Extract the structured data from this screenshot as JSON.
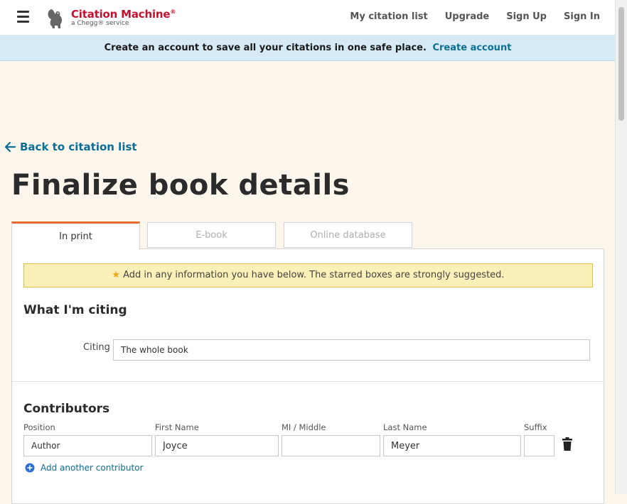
{
  "header": {
    "brand_name": "Citation Machine",
    "brand_mark": "®",
    "brand_sub": "a Chegg® service",
    "nav": [
      "My citation list",
      "Upgrade",
      "Sign Up",
      "Sign In"
    ]
  },
  "banner": {
    "text": "Create an account to save all your citations in one safe place.",
    "link": "Create account"
  },
  "back_link": "Back to citation list",
  "page_title": "Finalize book details",
  "tabs": [
    {
      "label": "In print",
      "active": true
    },
    {
      "label": "E-book",
      "active": false
    },
    {
      "label": "Online database",
      "active": false
    }
  ],
  "notice": "Add in any information you have below. The starred boxes are strongly suggested.",
  "citing_section": {
    "title": "What I'm citing",
    "label": "Citing",
    "value": "The whole book"
  },
  "contributors": {
    "title": "Contributors",
    "columns": [
      "Position",
      "First Name",
      "MI / Middle",
      "Last Name",
      "Suffix"
    ],
    "row": {
      "position": "Author",
      "first_name": "Joyce",
      "middle": "",
      "last_name": "Meyer",
      "suffix": ""
    },
    "add_label": "Add another contributor"
  },
  "colors": {
    "brand": "#c8102e",
    "link": "#0b6e94",
    "tab_accent": "#e46b2c",
    "notice_bg": "#fcf0b9",
    "banner_bg": "#d5eaf5",
    "page_bg": "#fdf6ec"
  },
  "icons": {
    "menu": "hamburger-icon",
    "logo": "squirrel-logo-icon",
    "back": "arrow-left-icon",
    "star": "star-icon",
    "delete": "trash-icon",
    "add": "plus-circle-icon"
  }
}
